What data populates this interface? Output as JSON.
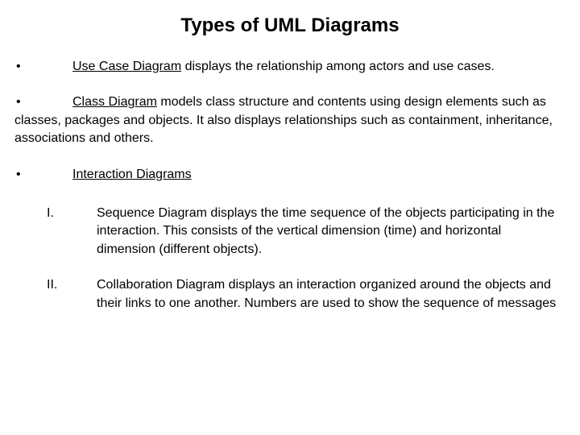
{
  "title": "Types of UML Diagrams",
  "bullet_char": "•",
  "items": {
    "use_case": {
      "link": "Use Case Diagram",
      "rest": " displays the relationship among actors and use cases."
    },
    "class_diag": {
      "link": "Class Diagram",
      "rest": " models class structure and contents using design elements such as classes, packages and objects. It also displays relationships such as containment, inheritance, associations and others."
    },
    "interaction": {
      "link": "Interaction Diagrams"
    }
  },
  "sub": {
    "one": {
      "num": "I.",
      "text": "Sequence Diagram displays the time sequence of the objects participating in the interaction.  This consists of the vertical dimension (time) and horizontal dimension (different objects)."
    },
    "two": {
      "num": "II.",
      "text": "Collaboration Diagram displays an interaction organized around the objects and their links to one another.  Numbers are used to show the sequence of messages"
    }
  }
}
